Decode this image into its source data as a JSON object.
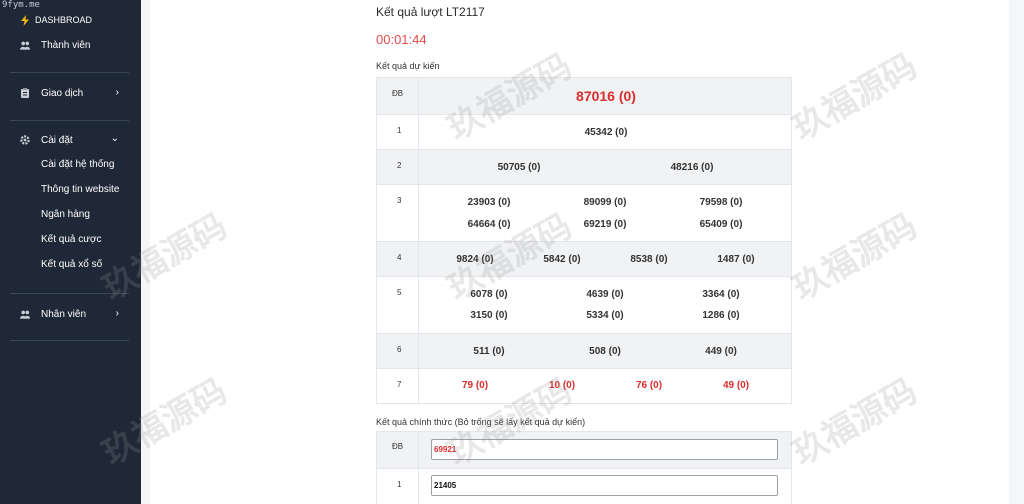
{
  "site_tag": "9fym.me",
  "sidebar": {
    "dashboard": "DASHBROAD",
    "members": "Thành viên",
    "transactions": "Giao dịch",
    "settings": "Cài đặt",
    "settings_sub": [
      "Cài đặt hệ thống",
      "Thông tin website",
      "Ngân hàng",
      "Kết quả cược",
      "Kết quả xổ số"
    ],
    "staff": "Nhân viên"
  },
  "main": {
    "round_title": "Kết quả lượt LT2117",
    "timer": "00:01:44",
    "predicted_title": "Kết quả dự kiến",
    "official_title": "Kết quả chính thức (Bỏ trống sẽ lấy kết quả dự kiến)",
    "predicted": [
      {
        "label": "ĐB",
        "values": [
          "87016 (0)"
        ]
      },
      {
        "label": "1",
        "values": [
          "45342 (0)"
        ]
      },
      {
        "label": "2",
        "values": [
          "50705 (0)",
          "48216 (0)"
        ]
      },
      {
        "label": "3",
        "values": [
          "23903 (0)",
          "89099 (0)",
          "79598 (0)",
          "64664 (0)",
          "69219 (0)",
          "65409 (0)"
        ]
      },
      {
        "label": "4",
        "values": [
          "9824 (0)",
          "5842 (0)",
          "8538 (0)",
          "1487 (0)"
        ]
      },
      {
        "label": "5",
        "values": [
          "6078 (0)",
          "4639 (0)",
          "3364 (0)",
          "3150 (0)",
          "5334 (0)",
          "1286 (0)"
        ]
      },
      {
        "label": "6",
        "values": [
          "511 (0)",
          "508 (0)",
          "449 (0)"
        ]
      },
      {
        "label": "7",
        "values": [
          "79 (0)",
          "10 (0)",
          "76 (0)",
          "49 (0)"
        ]
      }
    ],
    "official": [
      {
        "label": "ĐB",
        "value": "69921"
      },
      {
        "label": "1",
        "value": "21405"
      }
    ]
  },
  "watermark": "玖福源码",
  "colors": {
    "sidebar_bg": "#1f2836",
    "accent_red": "#d92d2d",
    "timer_red": "#e34c4c",
    "bolt_yellow": "#f5b800"
  }
}
